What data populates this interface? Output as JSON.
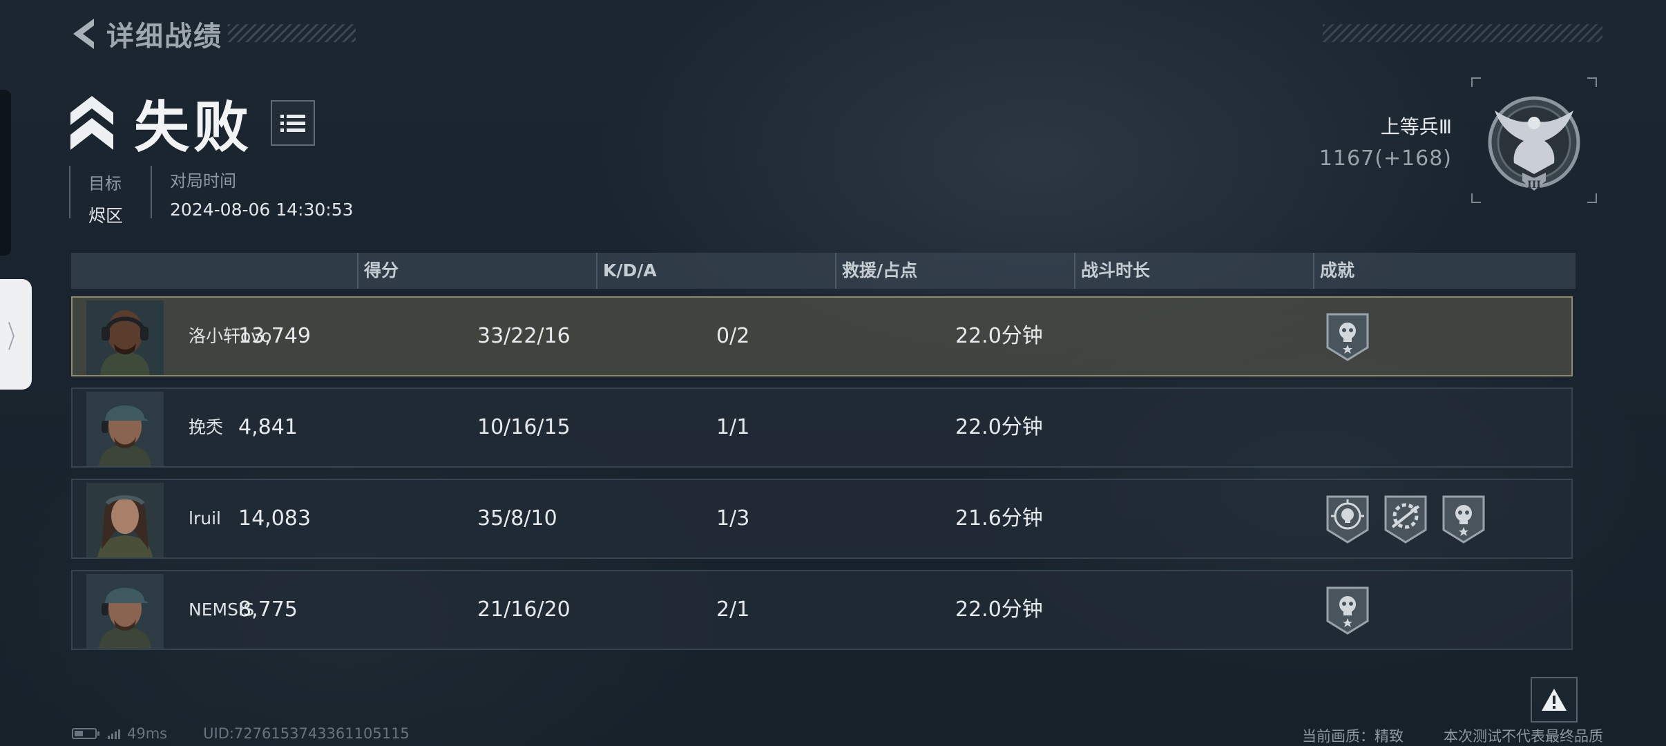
{
  "header": {
    "title": "详细战绩",
    "result": "失败"
  },
  "meta": {
    "target_label": "目标",
    "target_value": "烬区",
    "time_label": "对局时间",
    "time_value": "2024-08-06 14:30:53"
  },
  "rank": {
    "name": "上等兵Ⅲ",
    "points": "1167(+168)",
    "tier": "III"
  },
  "table": {
    "columns": [
      "得分",
      "K/D/A",
      "救援/占点",
      "战斗时长",
      "成就"
    ],
    "rows": [
      {
        "name": "洛小轩ovo",
        "score": "13,749",
        "kda": "33/22/16",
        "rescue": "0/2",
        "duration": "22.0分钟",
        "badges": [
          "skull-star-badge-icon"
        ],
        "highlight": true
      },
      {
        "name": "挽秂",
        "score": "4,841",
        "kda": "10/16/15",
        "rescue": "1/1",
        "duration": "22.0分钟",
        "badges": [],
        "highlight": false
      },
      {
        "name": "lruil",
        "score": "14,083",
        "kda": "35/8/10",
        "rescue": "1/3",
        "duration": "21.6分钟",
        "badges": [
          "crosshair-skull-badge-icon",
          "gear-rifle-badge-icon",
          "skull-star-badge-icon"
        ],
        "highlight": false
      },
      {
        "name": "NEMSIS",
        "score": "8,775",
        "kda": "21/16/20",
        "rescue": "2/1",
        "duration": "22.0分钟",
        "badges": [
          "skull-star-badge-icon"
        ],
        "highlight": false
      }
    ]
  },
  "footer": {
    "ping": "49ms",
    "uid": "UID:7276153743361105115",
    "quality": "当前画质：精致",
    "disclaimer": "本次测试不代表最终品质"
  },
  "icons": {
    "back": "back-arrow-icon",
    "result": "chevron-rank-icon",
    "list": "list-icon",
    "warning": "warning-icon",
    "side_tab": "chevron-right-icon"
  }
}
